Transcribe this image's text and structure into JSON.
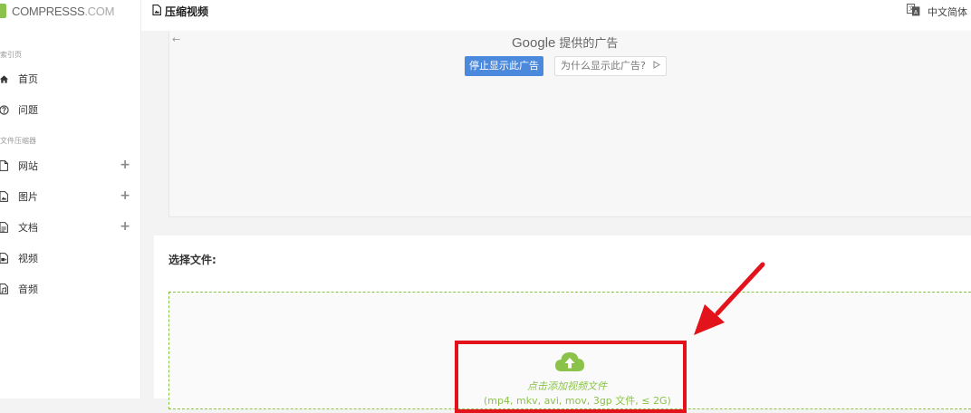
{
  "logo": {
    "text_main": "COMPRESSS",
    "text_com": ".COM"
  },
  "sidebar": {
    "section_index": "索引页",
    "section_tools": "文件压缩器",
    "items": [
      {
        "label": "首页",
        "icon": "home-icon",
        "has_plus": false
      },
      {
        "label": "问题",
        "icon": "question-icon",
        "has_plus": false
      },
      {
        "label": "网站",
        "icon": "file-icon",
        "has_plus": true
      },
      {
        "label": "图片",
        "icon": "image-file-icon",
        "has_plus": true
      },
      {
        "label": "文档",
        "icon": "document-icon",
        "has_plus": true
      },
      {
        "label": "视频",
        "icon": "video-file-icon",
        "has_plus": false
      },
      {
        "label": "音频",
        "icon": "audio-file-icon",
        "has_plus": false
      }
    ],
    "plus_glyph": "+"
  },
  "topbar": {
    "title": "压缩视频",
    "language": "中文简体"
  },
  "ad": {
    "back_glyph": "←",
    "google": "Google",
    "provided": "提供的广告",
    "stop_label": "停止显示此广告",
    "why_label": "为什么显示此广告?"
  },
  "panel": {
    "title": "选择文件:",
    "upload_text": "点击添加视频文件",
    "upload_sub": "(mp4, mkv, avi, mov, 3gp 文件, ≤ 2G)"
  },
  "colors": {
    "accent_green": "#8bc34a",
    "ad_blue": "#4a89dc",
    "highlight_red": "#e3131b"
  }
}
